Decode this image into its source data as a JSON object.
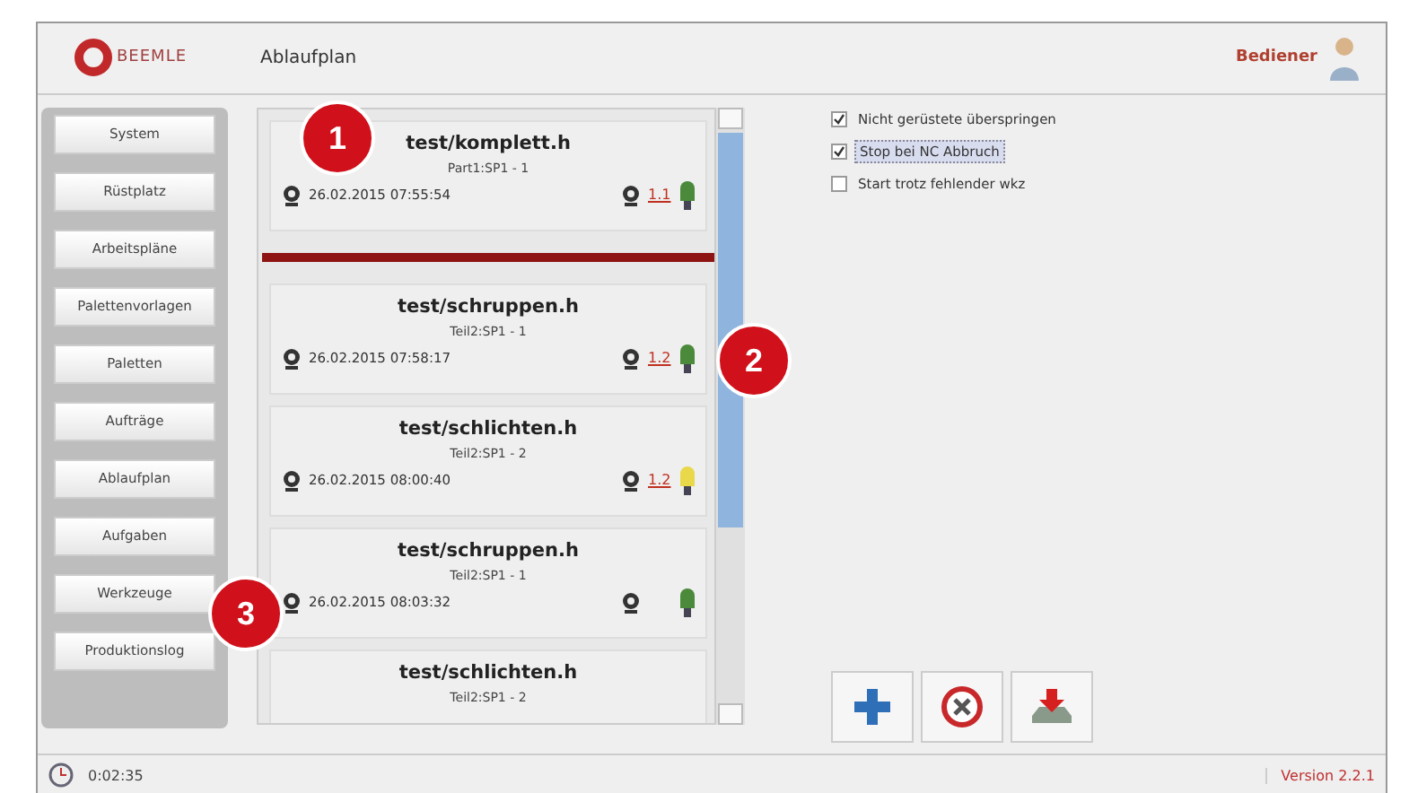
{
  "header": {
    "logo": "BEEMLE",
    "title": "Ablaufplan",
    "user": "Bediener"
  },
  "sidebar": {
    "items": [
      {
        "label": "System"
      },
      {
        "label": "Rüstplatz"
      },
      {
        "label": "Arbeitspläne"
      },
      {
        "label": "Palettenvorlagen"
      },
      {
        "label": "Paletten"
      },
      {
        "label": "Aufträge"
      },
      {
        "label": "Ablaufplan"
      },
      {
        "label": "Aufgaben"
      },
      {
        "label": "Werkzeuge"
      },
      {
        "label": "Produktionslog"
      }
    ]
  },
  "jobs": [
    {
      "title": "test/komplett.h",
      "part": "Part1:SP1 - 1",
      "time": "26.02.2015 07:55:54",
      "counter": "1.1",
      "color": "#4a8a3a"
    },
    {
      "kind": "divider"
    },
    {
      "title": "test/schruppen.h",
      "part": "Teil2:SP1 - 1",
      "time": "26.02.2015 07:58:17",
      "counter": "1.2",
      "color": "#4a8a3a"
    },
    {
      "title": "test/schlichten.h",
      "part": "Teil2:SP1 - 2",
      "time": "26.02.2015 08:00:40",
      "counter": "1.2",
      "color": "#e8d84a"
    },
    {
      "title": "test/schruppen.h",
      "part": "Teil2:SP1 - 1",
      "time": "26.02.2015 08:03:32",
      "color": "#4a8a3a"
    },
    {
      "title": "test/schlichten.h",
      "part": "Teil2:SP1 - 2"
    }
  ],
  "options": [
    {
      "label": "Nicht gerüstete überspringen",
      "checked": true,
      "selected": false
    },
    {
      "label": "Stop bei NC Abbruch",
      "checked": true,
      "selected": true
    },
    {
      "label": "Start trotz fehlender wkz",
      "checked": false,
      "selected": false
    }
  ],
  "callouts": [
    "1",
    "2",
    "3"
  ],
  "status_bar": {
    "clock": "0:02:35",
    "version": "Version 2.2.1"
  }
}
